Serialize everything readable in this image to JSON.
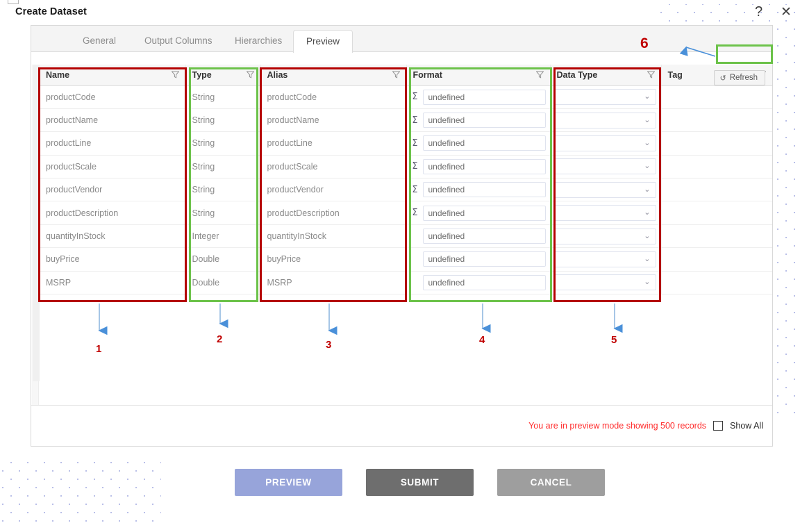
{
  "window": {
    "title": "Create Dataset",
    "help_icon": "question-mark-icon",
    "close_icon": "close-icon"
  },
  "tabs": [
    {
      "label": "General",
      "active": false
    },
    {
      "label": "Output Columns",
      "active": false
    },
    {
      "label": "Hierarchies",
      "active": false
    },
    {
      "label": "Preview",
      "active": true
    }
  ],
  "toolbar": {
    "refresh_label": "Refresh",
    "refresh_icon": "refresh-icon"
  },
  "grid": {
    "columns": [
      {
        "key": "name",
        "label": "Name",
        "filter_icon": "filter-funnel-icon"
      },
      {
        "key": "type",
        "label": "Type",
        "filter_icon": "filter-funnel-icon"
      },
      {
        "key": "alias",
        "label": "Alias",
        "filter_icon": "filter-funnel-icon"
      },
      {
        "key": "format",
        "label": "Format",
        "filter_icon": "filter-funnel-icon"
      },
      {
        "key": "data_type",
        "label": "Data Type",
        "filter_icon": "filter-funnel-icon"
      },
      {
        "key": "tag",
        "label": "Tag",
        "filter_icon": "filter-funnel-icon"
      }
    ],
    "rows": [
      {
        "name": "productCode",
        "type": "String",
        "alias": "productCode",
        "format": "undefined",
        "sigma": true,
        "data_type": "",
        "tag": ""
      },
      {
        "name": "productName",
        "type": "String",
        "alias": "productName",
        "format": "undefined",
        "sigma": true,
        "data_type": "",
        "tag": ""
      },
      {
        "name": "productLine",
        "type": "String",
        "alias": "productLine",
        "format": "undefined",
        "sigma": true,
        "data_type": "",
        "tag": ""
      },
      {
        "name": "productScale",
        "type": "String",
        "alias": "productScale",
        "format": "undefined",
        "sigma": true,
        "data_type": "",
        "tag": ""
      },
      {
        "name": "productVendor",
        "type": "String",
        "alias": "productVendor",
        "format": "undefined",
        "sigma": true,
        "data_type": "",
        "tag": ""
      },
      {
        "name": "productDescription",
        "type": "String",
        "alias": "productDescription",
        "format": "undefined",
        "sigma": true,
        "data_type": "",
        "tag": ""
      },
      {
        "name": "quantityInStock",
        "type": "Integer",
        "alias": "quantityInStock",
        "format": "undefined",
        "sigma": false,
        "data_type": "",
        "tag": ""
      },
      {
        "name": "buyPrice",
        "type": "Double",
        "alias": "buyPrice",
        "format": "undefined",
        "sigma": false,
        "data_type": "",
        "tag": ""
      },
      {
        "name": "MSRP",
        "type": "Double",
        "alias": "MSRP",
        "format": "undefined",
        "sigma": false,
        "data_type": "",
        "tag": ""
      }
    ],
    "sigma_glyph": "Σ",
    "chevron_glyph": "⌄"
  },
  "footer": {
    "preview_message": "You are in preview mode showing 500 records",
    "show_all_label": "Show All",
    "show_all_checked": false
  },
  "actions": [
    {
      "label": "PREVIEW",
      "color": "#97a4da"
    },
    {
      "label": "SUBMIT",
      "color": "#6e6e6e"
    },
    {
      "label": "CANCEL",
      "color": "#9e9e9e"
    }
  ],
  "annotations": {
    "numbers": [
      "1",
      "2",
      "3",
      "4",
      "5",
      "6"
    ],
    "highlight_red": "#b40000",
    "highlight_green": "#6cc24a",
    "arrow_color": "#5b9bd5",
    "number_color": "#c00000"
  }
}
